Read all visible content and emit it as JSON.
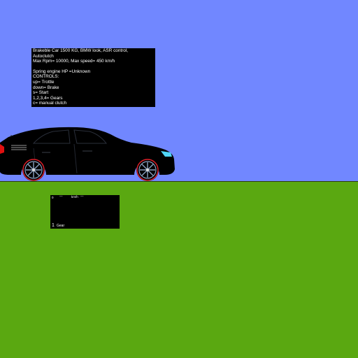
{
  "scene": {
    "sky_color": "#7187ff",
    "ground_color": "#5aa811",
    "car_body_color": "#000000",
    "tail_light_color": "#e01010",
    "head_light_color": "#4fd4f7",
    "rim_color": "#8aa0c0",
    "tire_accent_color": "#e0202a"
  },
  "info": {
    "lines": [
      "Brakeble Car 1500 KG, BMW look, ASR control,",
      "Autoclutch",
      "Max Rpm= 10000, Max speed= 450 km/h",
      "",
      "Spring engine HP =Unknown",
      "CONTROLS:",
      "up= Trottle",
      "down=  Brake",
      "s= Start",
      "1,2,3,4= Gears",
      "c= manual clutch"
    ]
  },
  "dashboard": {
    "rpm_readout": "0",
    "label_a": "—",
    "speed_unit": "km/h",
    "label_b": "—",
    "gear_value": "1",
    "gear_label": "Gear"
  }
}
